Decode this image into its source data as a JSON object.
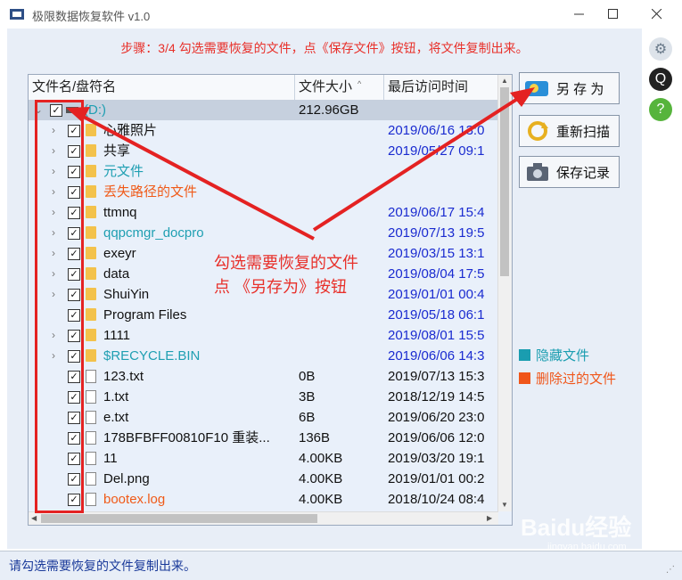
{
  "window": {
    "title": "极限数据恢复软件 v1.0"
  },
  "instruction": "步骤：3/4 勾选需要恢复的文件，点《保存文件》按钮，将文件复制出来。",
  "columns": {
    "name": "文件名/盘符名",
    "size": "文件大小",
    "date": "最后访问时间"
  },
  "rows": [
    {
      "name": "(D:)",
      "size": "212.96GB",
      "date": "",
      "icon": "drive",
      "expander": "⌄",
      "style": "hidden-c",
      "selected": true,
      "indent": 0
    },
    {
      "name": "心雅照片",
      "size": "",
      "date": "2019/06/16 13:0",
      "icon": "folder",
      "expander": "›",
      "style": "",
      "selected": false,
      "indent": 1
    },
    {
      "name": "共享",
      "size": "",
      "date": "2019/05/27 09:1",
      "icon": "folder",
      "expander": "›",
      "style": "",
      "selected": false,
      "indent": 1
    },
    {
      "name": "元文件",
      "size": "",
      "date": "",
      "icon": "folder",
      "expander": "›",
      "style": "hidden-c",
      "selected": false,
      "indent": 1
    },
    {
      "name": "丢失路径的文件",
      "size": "",
      "date": "",
      "icon": "folder",
      "expander": "›",
      "style": "deleted-c",
      "selected": false,
      "indent": 1
    },
    {
      "name": "ttmnq",
      "size": "",
      "date": "2019/06/17 15:4",
      "icon": "folder",
      "expander": "›",
      "style": "",
      "selected": false,
      "indent": 1
    },
    {
      "name": "qqpcmgr_docpro",
      "size": "",
      "date": "2019/07/13 19:5",
      "icon": "folder",
      "expander": "›",
      "style": "hidden-c",
      "selected": false,
      "indent": 1
    },
    {
      "name": "exeyr",
      "size": "",
      "date": "2019/03/15 13:1",
      "icon": "folder",
      "expander": "›",
      "style": "",
      "selected": false,
      "indent": 1
    },
    {
      "name": "data",
      "size": "",
      "date": "2019/08/04 17:5",
      "icon": "folder",
      "expander": "›",
      "style": "",
      "selected": false,
      "indent": 1
    },
    {
      "name": "ShuiYin",
      "size": "",
      "date": "2019/01/01 00:4",
      "icon": "folder",
      "expander": "›",
      "style": "",
      "selected": false,
      "indent": 1
    },
    {
      "name": "Program Files",
      "size": "",
      "date": "2019/05/18 06:1",
      "icon": "folder",
      "expander": "",
      "style": "",
      "selected": false,
      "indent": 1
    },
    {
      "name": "1111",
      "size": "",
      "date": "2019/08/01 15:5",
      "icon": "folder",
      "expander": "›",
      "style": "",
      "selected": false,
      "indent": 1
    },
    {
      "name": "$RECYCLE.BIN",
      "size": "",
      "date": "2019/06/06 14:3",
      "icon": "folder",
      "expander": "›",
      "style": "hidden-c",
      "selected": false,
      "indent": 1
    },
    {
      "name": "123.txt",
      "size": "0B",
      "date": "2019/07/13 15:3",
      "icon": "doc",
      "expander": "",
      "style": "",
      "selected": false,
      "indent": 1
    },
    {
      "name": "1.txt",
      "size": "3B",
      "date": "2018/12/19 14:5",
      "icon": "doc",
      "expander": "",
      "style": "",
      "selected": false,
      "indent": 1
    },
    {
      "name": "e.txt",
      "size": "6B",
      "date": "2019/06/20 23:0",
      "icon": "doc",
      "expander": "",
      "style": "",
      "selected": false,
      "indent": 1
    },
    {
      "name": "178BFBFF00810F10  重装...",
      "size": "136B",
      "date": "2019/06/06 12:0",
      "icon": "doc",
      "expander": "",
      "style": "",
      "selected": false,
      "indent": 1
    },
    {
      "name": "11",
      "size": "4.00KB",
      "date": "2019/03/20 19:1",
      "icon": "doc",
      "expander": "",
      "style": "",
      "selected": false,
      "indent": 1
    },
    {
      "name": "Del.png",
      "size": "4.00KB",
      "date": "2019/01/01 00:2",
      "icon": "doc",
      "expander": "",
      "style": "",
      "selected": false,
      "indent": 1
    },
    {
      "name": "bootex.log",
      "size": "4.00KB",
      "date": "2018/10/24 08:4",
      "icon": "doc",
      "expander": "",
      "style": "deleted-c",
      "selected": false,
      "indent": 1
    }
  ],
  "buttons": {
    "save_as": "另 存 为",
    "rescan": "重新扫描",
    "save_log": "保存记录"
  },
  "legend": {
    "hidden": "隐藏文件",
    "deleted": "删除过的文件",
    "hidden_color": "#1a9db0",
    "deleted_color": "#f0561a"
  },
  "annotation": {
    "line1": "勾选需要恢复的文件",
    "line2": "点 《另存为》按钮"
  },
  "status": "请勾选需要恢复的文件复制出来。",
  "watermark": {
    "main": "Baidu经验",
    "sub": "jingyan.baidu.com"
  },
  "colors": {
    "accent_red": "#e8302a",
    "hidden_cyan": "#1f9fb2",
    "deleted_orange": "#f05a18",
    "date_blue": "#1a2bd0"
  }
}
